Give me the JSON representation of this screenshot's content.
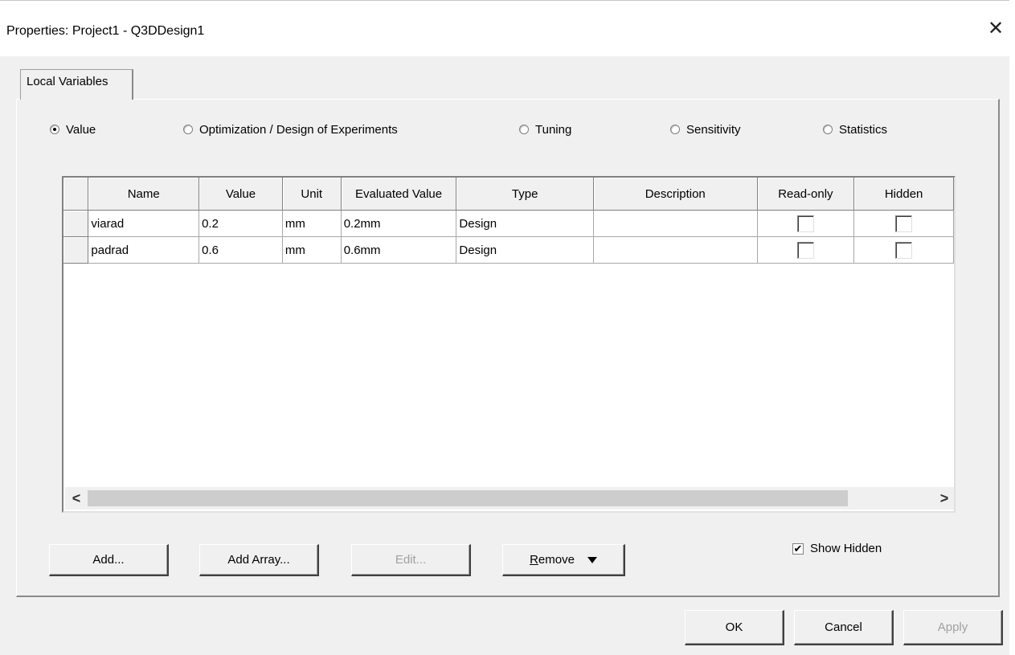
{
  "window": {
    "title": "Properties: Project1 - Q3DDesign1",
    "close_glyph": "✕"
  },
  "tabs": [
    {
      "label": "Local Variables"
    }
  ],
  "radios": [
    {
      "label": "Value",
      "selected": true
    },
    {
      "label": "Optimization / Design of Experiments",
      "selected": false
    },
    {
      "label": "Tuning",
      "selected": false
    },
    {
      "label": "Sensitivity",
      "selected": false
    },
    {
      "label": "Statistics",
      "selected": false
    }
  ],
  "table": {
    "columns": [
      "Name",
      "Value",
      "Unit",
      "Evaluated Value",
      "Type",
      "Description",
      "Read-only",
      "Hidden"
    ],
    "rows": [
      {
        "name": "viarad",
        "value": "0.2",
        "unit": "mm",
        "evaluated": "0.2mm",
        "type": "Design",
        "description": "",
        "read_only": false,
        "hidden": false
      },
      {
        "name": "padrad",
        "value": "0.6",
        "unit": "mm",
        "evaluated": "0.6mm",
        "type": "Design",
        "description": "",
        "read_only": false,
        "hidden": false
      }
    ]
  },
  "scroll": {
    "left_glyph": "<",
    "right_glyph": ">"
  },
  "buttons": {
    "add": "Add...",
    "add_array": "Add Array...",
    "edit": "Edit...",
    "remove_mnemonic": "R",
    "remove_rest": "emove"
  },
  "show_hidden": {
    "label": "Show Hidden",
    "checked": true,
    "check_glyph": "✔"
  },
  "dialog_buttons": {
    "ok": "OK",
    "cancel": "Cancel",
    "apply": "Apply"
  }
}
